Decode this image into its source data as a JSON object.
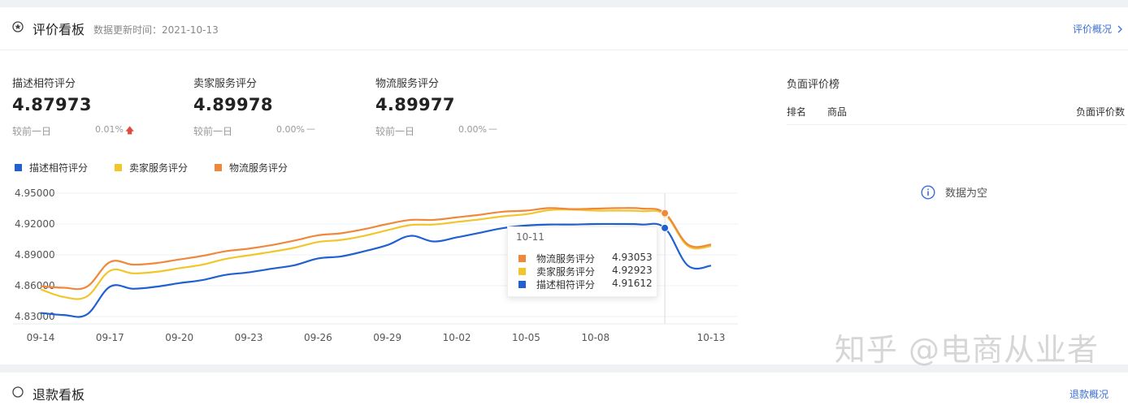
{
  "header": {
    "title": "评价看板",
    "update_time": "数据更新时间：2021-10-13",
    "overview_link": "评价概况"
  },
  "metrics": [
    {
      "label": "描述相符评分",
      "value": "4.87973",
      "compare_label": "较前一日",
      "change": "0.01%",
      "trend": "up",
      "trend_glyph": "🡅"
    },
    {
      "label": "卖家服务评分",
      "value": "4.89978",
      "compare_label": "较前一日",
      "change": "0.00%",
      "trend": "flat",
      "trend_glyph": "—"
    },
    {
      "label": "物流服务评分",
      "value": "4.89977",
      "compare_label": "较前一日",
      "change": "0.00%",
      "trend": "flat",
      "trend_glyph": "—"
    }
  ],
  "colors": {
    "blue": "#2060d0",
    "yellow": "#f0c62a",
    "orange": "#f0883c",
    "link": "#3b6fd8",
    "up": "#e04a3f"
  },
  "chart_data": {
    "type": "line",
    "ylim": [
      4.83,
      4.95
    ],
    "y_ticks": [
      "4.83000",
      "4.86000",
      "4.89000",
      "4.92000",
      "4.95000"
    ],
    "x_tick_labels": [
      "09-14",
      "09-17",
      "09-20",
      "09-23",
      "09-26",
      "09-29",
      "10-02",
      "10-05",
      "10-08",
      "10-13"
    ],
    "x": [
      "09-14",
      "09-15",
      "09-16",
      "09-17",
      "09-18",
      "09-19",
      "09-20",
      "09-21",
      "09-22",
      "09-23",
      "09-24",
      "09-25",
      "09-26",
      "09-27",
      "09-28",
      "09-29",
      "09-30",
      "10-01",
      "10-02",
      "10-03",
      "10-04",
      "10-05",
      "10-06",
      "10-07",
      "10-08",
      "10-09",
      "10-10",
      "10-11",
      "10-12",
      "10-13"
    ],
    "legend": [
      "描述相符评分",
      "卖家服务评分",
      "物流服务评分"
    ],
    "series": [
      {
        "name": "描述相符评分",
        "color": "#2060d0",
        "values": [
          4.8335,
          4.8315,
          4.832,
          4.859,
          4.857,
          4.859,
          4.8625,
          4.8655,
          4.8705,
          4.873,
          4.8765,
          4.88,
          4.8865,
          4.8885,
          4.8935,
          4.8995,
          4.9085,
          4.903,
          4.907,
          4.9115,
          4.916,
          4.9185,
          4.9195,
          4.9195,
          4.92,
          4.92,
          4.9195,
          4.91612,
          4.8795,
          4.8795
        ]
      },
      {
        "name": "卖家服务评分",
        "color": "#f0c62a",
        "values": [
          4.8565,
          4.849,
          4.8495,
          4.8745,
          4.872,
          4.8735,
          4.877,
          4.8805,
          4.886,
          4.8895,
          4.893,
          4.897,
          4.9025,
          4.9045,
          4.9085,
          4.914,
          4.919,
          4.9195,
          4.922,
          4.9245,
          4.9275,
          4.9295,
          4.9335,
          4.934,
          4.933,
          4.933,
          4.9325,
          4.92923,
          4.8985,
          4.8985
        ]
      },
      {
        "name": "物流服务评分",
        "color": "#f0883c",
        "values": [
          4.8595,
          4.858,
          4.859,
          4.883,
          4.8805,
          4.882,
          4.8855,
          4.889,
          4.8935,
          4.896,
          4.8995,
          4.904,
          4.909,
          4.911,
          4.915,
          4.92,
          4.924,
          4.924,
          4.9265,
          4.929,
          4.932,
          4.933,
          4.9355,
          4.9345,
          4.935,
          4.9355,
          4.935,
          4.93053,
          4.9,
          4.9
        ]
      }
    ],
    "hover_index": 27,
    "grid": true
  },
  "tooltip": {
    "date": "10-11",
    "rows": [
      {
        "name": "物流服务评分",
        "value": "4.93053",
        "color": "#f0883c"
      },
      {
        "name": "卖家服务评分",
        "value": "4.92923",
        "color": "#f0c62a"
      },
      {
        "name": "描述相符评分",
        "value": "4.91612",
        "color": "#2060d0"
      }
    ]
  },
  "negative_panel": {
    "title": "负面评价榜",
    "columns": [
      "排名",
      "商品",
      "负面评价数"
    ],
    "empty_text": "数据为空"
  },
  "next_card": {
    "title": "退款看板",
    "link": "退款概况"
  },
  "watermark": "知乎 @电商从业者"
}
